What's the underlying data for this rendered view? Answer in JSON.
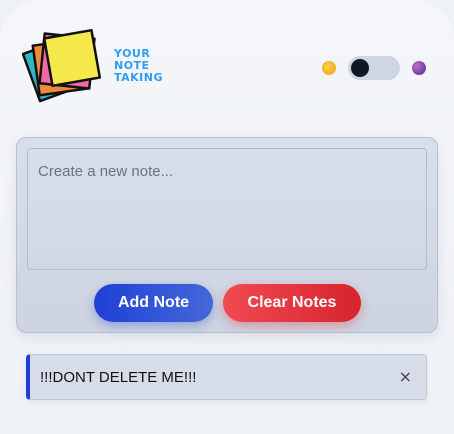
{
  "header": {
    "logo_lines": [
      "YOUR",
      "NOTE",
      "TAKING"
    ],
    "logo_color": "#2f9df0",
    "theme_toggle": {
      "left_icon": "sun-icon",
      "right_icon": "moon-icon",
      "state": "light"
    }
  },
  "composer": {
    "placeholder": "Create a new note...",
    "value": "",
    "add_label": "Add Note",
    "clear_label": "Clear Notes",
    "add_color": "#1f3fd6",
    "clear_color": "#e8363e"
  },
  "notes": [
    {
      "text": "!!!DONT DELETE ME!!!",
      "close_glyph": "×",
      "accent_color": "#1d3ed8"
    }
  ]
}
